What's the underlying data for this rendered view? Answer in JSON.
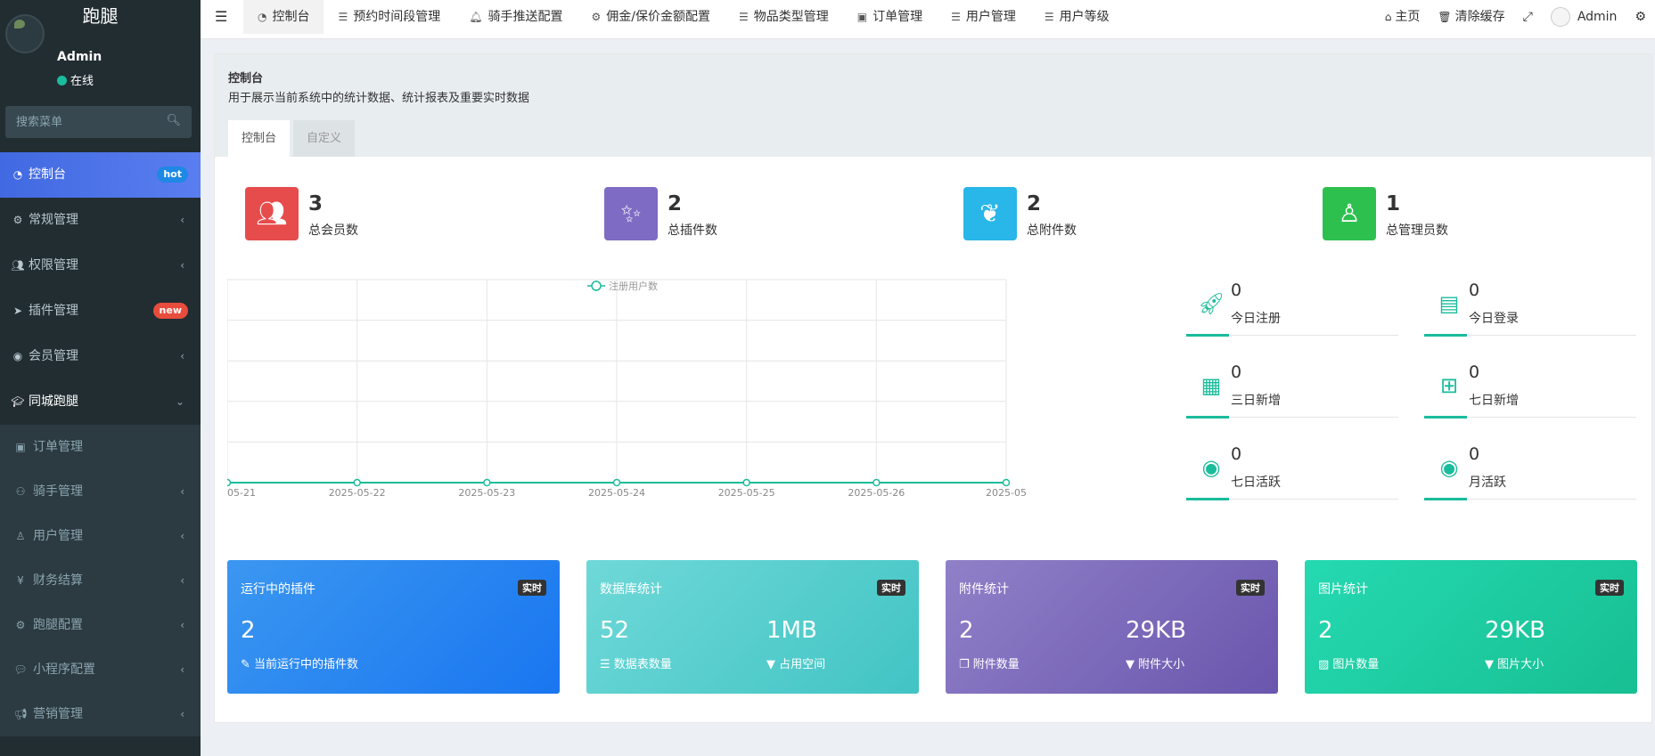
{
  "app": {
    "logo": "跑腿"
  },
  "user": {
    "name": "Admin",
    "status": "在线"
  },
  "sidebar": {
    "search_placeholder": "搜索菜单",
    "items": [
      {
        "label": "控制台",
        "icon": "dashboard-icon",
        "badge": "hot"
      },
      {
        "label": "常规管理",
        "icon": "cogs-icon"
      },
      {
        "label": "权限管理",
        "icon": "group-icon"
      },
      {
        "label": "插件管理",
        "icon": "rocket-icon",
        "badge": "new"
      },
      {
        "label": "会员管理",
        "icon": "user-circle-icon"
      },
      {
        "label": "同城跑腿",
        "icon": "graduation-cap-icon"
      }
    ],
    "subitems": [
      {
        "label": "订单管理",
        "icon": "list-alt-icon"
      },
      {
        "label": "骑手管理",
        "icon": "motorcycle-icon"
      },
      {
        "label": "用户管理",
        "icon": "user-icon"
      },
      {
        "label": "财务结算",
        "icon": "yen-icon"
      },
      {
        "label": "跑腿配置",
        "icon": "cogs-icon"
      },
      {
        "label": "小程序配置",
        "icon": "comments-icon"
      },
      {
        "label": "营销管理",
        "icon": "bullhorn-icon"
      }
    ]
  },
  "topbar": {
    "tabs": [
      {
        "label": "控制台",
        "icon": "dashboard-icon"
      },
      {
        "label": "预约时间段管理",
        "icon": "list-icon"
      },
      {
        "label": "骑手推送配置",
        "icon": "bell-icon"
      },
      {
        "label": "佣金/保价金额配置",
        "icon": "gear-icon"
      },
      {
        "label": "物品类型管理",
        "icon": "list-icon"
      },
      {
        "label": "订单管理",
        "icon": "list-alt-icon"
      },
      {
        "label": "用户管理",
        "icon": "list-icon"
      },
      {
        "label": "用户等级",
        "icon": "list-icon"
      }
    ],
    "right": {
      "home": "主页",
      "clear_cache": "清除缓存",
      "user": "Admin"
    }
  },
  "panel": {
    "title": "控制台",
    "description": "用于展示当前系统中的统计数据、统计报表及重要实时数据",
    "tabs": [
      "控制台",
      "自定义"
    ]
  },
  "stats": [
    {
      "value": "3",
      "label": "总会员数",
      "color": "#e74c4c",
      "icon": "users-icon"
    },
    {
      "value": "2",
      "label": "总插件数",
      "color": "#7e6bc4",
      "icon": "magic-icon"
    },
    {
      "value": "2",
      "label": "总附件数",
      "color": "#29b6e8",
      "icon": "leaf-icon"
    },
    {
      "value": "1",
      "label": "总管理员数",
      "color": "#2ec04f",
      "icon": "user-icon"
    }
  ],
  "mini_stats": [
    {
      "value": "0",
      "label": "今日注册",
      "icon": "rocket-icon"
    },
    {
      "value": "0",
      "label": "今日登录",
      "icon": "vcard-icon"
    },
    {
      "value": "0",
      "label": "三日新增",
      "icon": "calendar-icon"
    },
    {
      "value": "0",
      "label": "七日新增",
      "icon": "calendar-plus-icon"
    },
    {
      "value": "0",
      "label": "七日活跃",
      "icon": "user-circle-icon"
    },
    {
      "value": "0",
      "label": "月活跃",
      "icon": "user-circle-icon"
    }
  ],
  "cards": [
    {
      "title": "运行中的插件",
      "tag": "实时",
      "items": [
        {
          "value": "2",
          "label": "当前运行中的插件数"
        }
      ]
    },
    {
      "title": "数据库统计",
      "tag": "实时",
      "items": [
        {
          "value": "52",
          "label": "数据表数量"
        },
        {
          "value": "1MB",
          "label": "占用空间"
        }
      ]
    },
    {
      "title": "附件统计",
      "tag": "实时",
      "items": [
        {
          "value": "2",
          "label": "附件数量"
        },
        {
          "value": "29KB",
          "label": "附件大小"
        }
      ]
    },
    {
      "title": "图片统计",
      "tag": "实时",
      "items": [
        {
          "value": "2",
          "label": "图片数量"
        },
        {
          "value": "29KB",
          "label": "图片大小"
        }
      ]
    }
  ],
  "chart_data": {
    "type": "line",
    "x": [
      "05-21",
      "2025-05-22",
      "2025-05-23",
      "2025-05-24",
      "2025-05-25",
      "2025-05-26",
      "2025-05"
    ],
    "series": [
      {
        "name": "注册用户数",
        "values": [
          0,
          0,
          0,
          0,
          0,
          0,
          0
        ],
        "color": "#1abc9c"
      }
    ],
    "grid": true,
    "legend": "top-center"
  }
}
